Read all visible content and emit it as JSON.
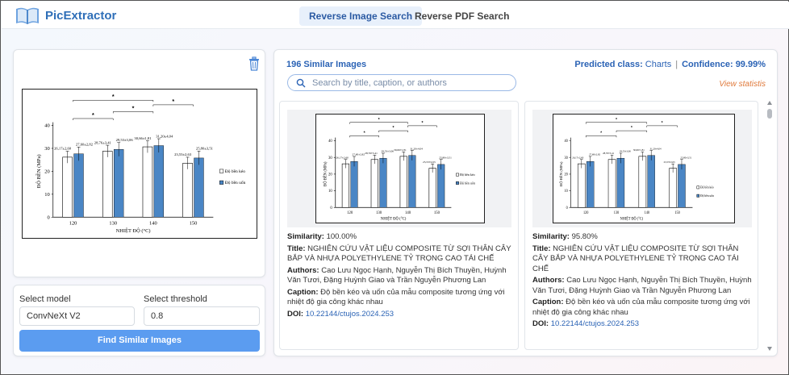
{
  "app": {
    "name": "PicExtractor"
  },
  "tabs": [
    {
      "label": "Reverse Image Search",
      "active": true
    },
    {
      "label": "Reverse PDF Search",
      "active": false
    }
  ],
  "query_chart": {
    "ylabel": "ĐỘ BỀN (MPa)",
    "xlabel": "NHIỆT ĐỘ (°C)",
    "yticks": [
      "0",
      "10",
      "20",
      "30",
      "40"
    ],
    "categories": [
      "120",
      "130",
      "140",
      "150"
    ],
    "legend": [
      "Độ bền kéo",
      "Độ bền uốn"
    ],
    "kéo": [
      26.17,
      28.76,
      30.66,
      23.53
    ],
    "uốn": [
      27.6,
      29.53,
      31.2,
      25.8
    ],
    "labels_keo": [
      "26,17±2,60",
      "28,76±3,41",
      "30,66±1,81",
      "23,53±2,63"
    ],
    "labels_uon": [
      "27,60±2,82",
      "29,53±3,06",
      "31,20±4,04",
      "25,80±3,51"
    ],
    "sig": [
      "*",
      "*",
      "*",
      "*"
    ]
  },
  "controls": {
    "model_label": "Select model",
    "model_value": "ConvNeXt V2",
    "threshold_label": "Select threshold",
    "threshold_value": "0.8",
    "find_button": "Find Similar Images"
  },
  "results": {
    "count_text": "196 Similar Images",
    "predicted_label": "Predicted class:",
    "predicted_value": "Charts",
    "confidence_label": "Confidence:",
    "confidence_value": "99.99%",
    "search_placeholder": "Search by title, caption, or authors",
    "view_stats": "View statistis"
  },
  "cards": [
    {
      "similarity_label": "Similarity:",
      "similarity": "100.00%",
      "title_label": "Title:",
      "title": "NGHIÊN CỨU VẬT LIỆU COMPOSITE TỪ SỢI THÂN CÂY BẮP VÀ NHỰA POLYETHYLENE TỶ TRỌNG CAO TÁI CHẾ",
      "authors_label": "Authors:",
      "authors": "Cao Lưu Ngọc Hạnh, Nguyễn Thị Bích Thuyền, Huỳnh Văn Tươi, Đặng Huỳnh Giao và Trần Nguyễn Phương Lan",
      "caption_label": "Caption:",
      "caption": "Độ bền kéo và uốn của mẫu composite tương ứng với nhiệt độ gia công khác nhau",
      "doi_label": "DOI:",
      "doi": "10.22144/ctujos.2024.253"
    },
    {
      "similarity_label": "Similarity:",
      "similarity": "95.80%",
      "title_label": "Title:",
      "title": "NGHIÊN CỨU VẬT LIỆU COMPOSITE TỪ SỢI THÂN CÂY BẮP VÀ NHỰA POLYETHYLENE TỶ TRỌNG CAO TÁI CHẾ",
      "authors_label": "Authors:",
      "authors": "Cao Lưu Ngọc Hạnh, Nguyễn Thị Bích Thuyền, Huỳnh Văn Tươi, Đặng Huỳnh Giao và Trần Nguyễn Phương Lan",
      "caption_label": "Caption:",
      "caption": "Độ bền kéo và uốn của mẫu composite tương ứng với nhiệt độ gia công khác nhau",
      "doi_label": "DOI:",
      "doi": "10.22144/ctujos.2024.253"
    }
  ],
  "colors": {
    "accent": "#2b63b5",
    "button": "#5b9cf0",
    "bar_uon": "#4a86c5",
    "stats": "#e07a3c"
  }
}
